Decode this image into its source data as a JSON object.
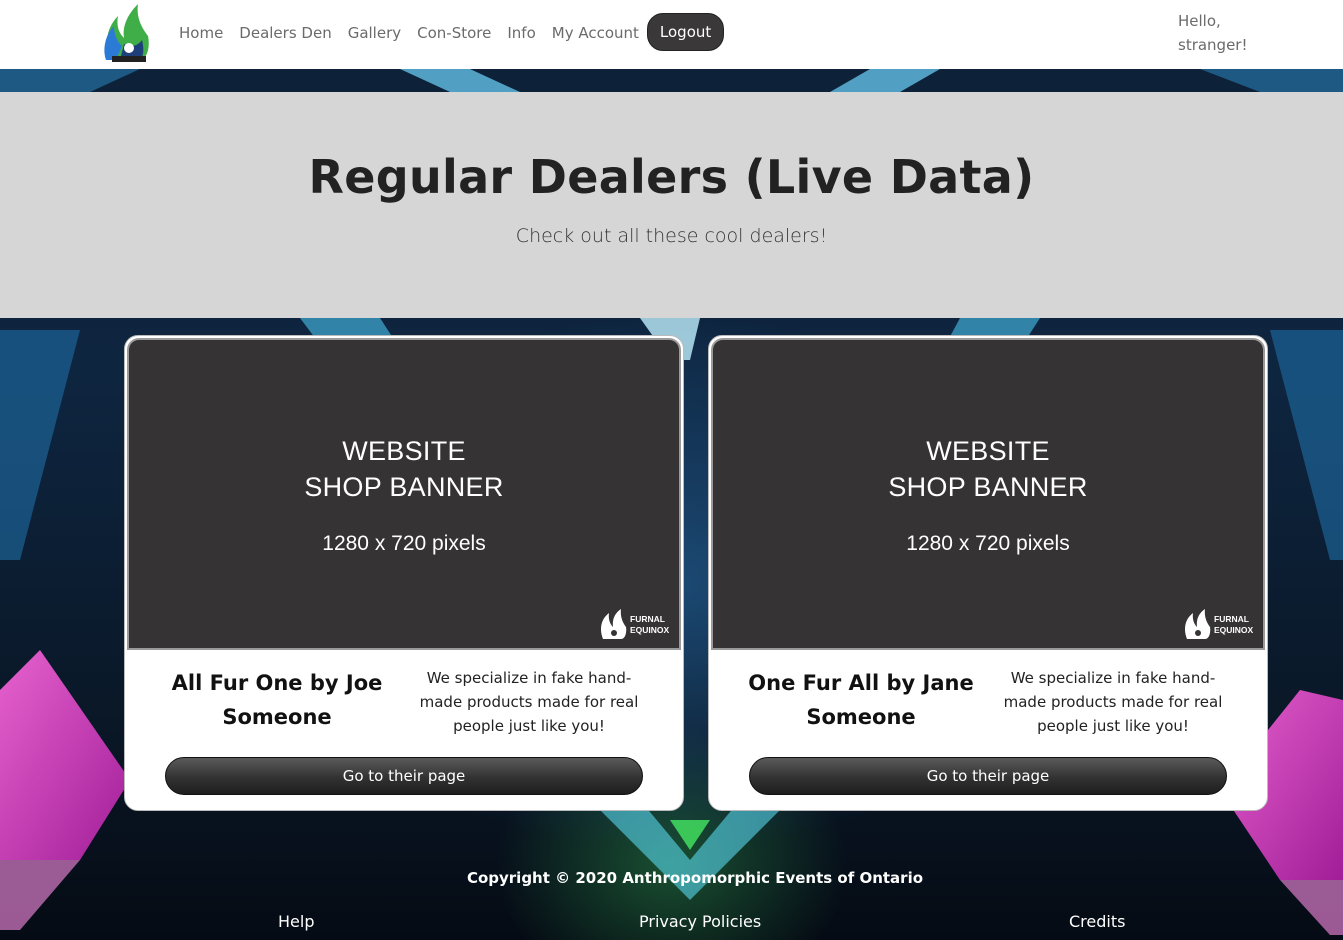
{
  "nav": {
    "links": [
      "Home",
      "Dealers Den",
      "Gallery",
      "Con-Store",
      "Info",
      "My Account"
    ],
    "logout_label": "Logout",
    "greeting": "Hello, stranger!"
  },
  "hero": {
    "title": "Regular Dealers (Live Data)",
    "subtitle": "Check out all these cool dealers!"
  },
  "dealers": [
    {
      "banner": {
        "line1": "WEBSITE",
        "line2": "SHOP BANNER",
        "line3": "1280 x 720 pixels",
        "brand_line1": "FURNAL",
        "brand_line2": "EQUINOX"
      },
      "name": "All Fur One by Joe Someone",
      "description": "We specialize in fake hand-made products made for real people just like you!",
      "button_label": "Go to their page"
    },
    {
      "banner": {
        "line1": "WEBSITE",
        "line2": "SHOP BANNER",
        "line3": "1280 x 720 pixels",
        "brand_line1": "FURNAL",
        "brand_line2": "EQUINOX"
      },
      "name": "One Fur All by Jane Someone",
      "description": "We specialize in fake hand-made products made for real people just like you!",
      "button_label": "Go to their page"
    }
  ],
  "footer": {
    "copyright": "Copyright © 2020 Anthropomorphic Events of Ontario",
    "links": [
      "Help",
      "Privacy Policies",
      "Credits"
    ]
  },
  "colors": {
    "navbar_bg": "#ffffff",
    "hero_bg": "#d6d6d6",
    "card_bg": "#ffffff",
    "banner_bg": "#353334",
    "button_bg": "#323232",
    "accent_cyan": "#3ec8ff",
    "accent_magenta": "#ff4fd8",
    "accent_green": "#3bd46b"
  },
  "icons": {
    "logo": "furnal-equinox-logo",
    "banner_brand": "furnal-equinox-logo"
  }
}
